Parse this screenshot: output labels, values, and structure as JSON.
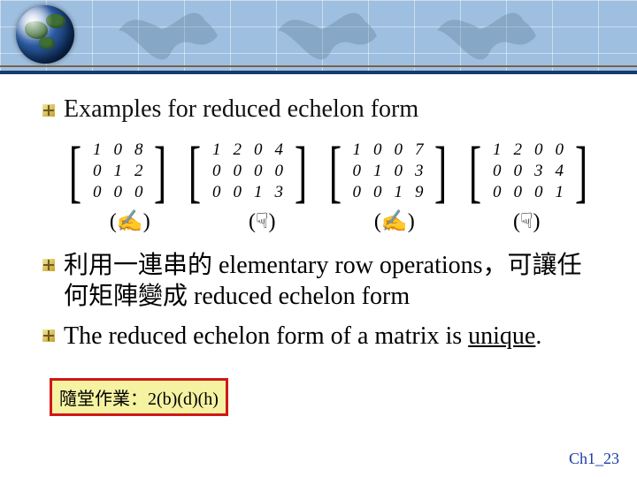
{
  "heading1": "Examples for reduced echelon form",
  "matrices": [
    {
      "rows": [
        [
          "1",
          "0",
          "8"
        ],
        [
          "0",
          "1",
          "2"
        ],
        [
          "0",
          "0",
          "0"
        ]
      ],
      "label_type": "write"
    },
    {
      "rows": [
        [
          "1",
          "2",
          "0",
          "4"
        ],
        [
          "0",
          "0",
          "0",
          "0"
        ],
        [
          "0",
          "0",
          "1",
          "3"
        ]
      ],
      "label_type": "point"
    },
    {
      "rows": [
        [
          "1",
          "0",
          "0",
          "7"
        ],
        [
          "0",
          "1",
          "0",
          "3"
        ],
        [
          "0",
          "0",
          "1",
          "9"
        ]
      ],
      "label_type": "write"
    },
    {
      "rows": [
        [
          "1",
          "2",
          "0",
          "0"
        ],
        [
          "0",
          "0",
          "3",
          "4"
        ],
        [
          "0",
          "0",
          "0",
          "1"
        ]
      ],
      "label_type": "point"
    }
  ],
  "labels": {
    "write": "(✍)",
    "point": "(☟)"
  },
  "bullets": [
    "利用一連串的 elementary row operations，可讓任何矩陣變成 reduced echelon form",
    "The reduced echelon form of a matrix is "
  ],
  "unique_word": "unique",
  "period": ".",
  "homework": "隨堂作業：2(b)(d)(h)",
  "slide_footer": "Ch1_23"
}
